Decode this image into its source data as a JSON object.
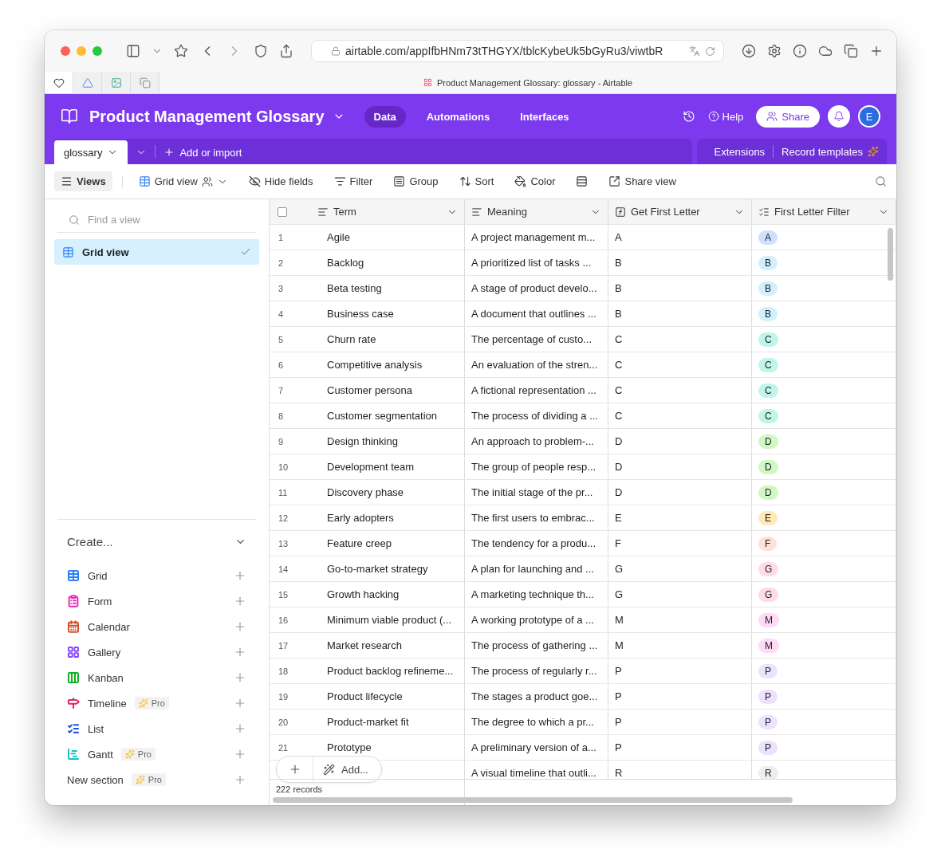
{
  "browser": {
    "url": "airtable.com/appIfbHNm73tTHGYX/tblcKybeUk5bGyRu3/viwtbR",
    "tab_title": "Product Management Glossary: glossary - Airtable"
  },
  "header": {
    "title": "Product Management Glossary",
    "nav": [
      {
        "label": "Data",
        "selected": true
      },
      {
        "label": "Automations",
        "selected": false
      },
      {
        "label": "Interfaces",
        "selected": false
      }
    ],
    "help": "Help",
    "share": "Share",
    "avatar": "E"
  },
  "table_tabs": {
    "tabs": [
      {
        "label": "glossary",
        "selected": true
      }
    ],
    "add": "Add or import",
    "right": [
      "Extensions",
      "Record templates"
    ]
  },
  "toolbar": {
    "views": "Views",
    "view_name": "Grid view",
    "buttons": [
      {
        "label": "Hide fields",
        "kind": "hide"
      },
      {
        "label": "Filter",
        "kind": "filter"
      },
      {
        "label": "Group",
        "kind": "group"
      },
      {
        "label": "Sort",
        "kind": "sort"
      },
      {
        "label": "Color",
        "kind": "color"
      },
      {
        "kind": "height"
      },
      {
        "label": "Share view",
        "kind": "share"
      }
    ]
  },
  "sidebar": {
    "search": {
      "placeholder": "Find a view"
    },
    "views": [
      {
        "label": "Grid view",
        "selected": true
      }
    ],
    "create_title": "Create...",
    "create_items": [
      {
        "label": "Grid",
        "kind": "grid",
        "color": "#2d7ff9"
      },
      {
        "label": "Form",
        "kind": "form",
        "color": "#e929ba"
      },
      {
        "label": "Calendar",
        "kind": "calendar",
        "color": "#d74d26"
      },
      {
        "label": "Gallery",
        "kind": "gallery",
        "color": "#8b46ff"
      },
      {
        "label": "Kanban",
        "kind": "kanban",
        "color": "#11af22"
      },
      {
        "label": "Timeline",
        "kind": "timeline",
        "color": "#e0245e",
        "badge": "Pro"
      },
      {
        "label": "List",
        "kind": "list",
        "color": "#1d4ed8"
      },
      {
        "label": "Gantt",
        "kind": "gantt",
        "color": "#18bfbf",
        "badge": "Pro"
      },
      {
        "label": "New section",
        "kind": "section",
        "badge": "Pro"
      }
    ]
  },
  "table": {
    "select_all": {
      "checked": false
    },
    "columns": [
      {
        "label": "Term",
        "kind": "text"
      },
      {
        "label": "Meaning",
        "kind": "text"
      },
      {
        "label": "Get First Letter",
        "kind": "formula"
      },
      {
        "label": "First Letter Filter",
        "kind": "select"
      }
    ],
    "rows": [
      {
        "number": "1",
        "term": "Agile",
        "meaning": "A project management m...",
        "letter": "A",
        "tag": {
          "label": "A",
          "color": "#cfdfff"
        }
      },
      {
        "number": "2",
        "term": "Backlog",
        "meaning": "A prioritized list of tasks ...",
        "letter": "B",
        "tag": {
          "label": "B",
          "color": "#d0f0fd"
        }
      },
      {
        "number": "3",
        "term": "Beta testing",
        "meaning": "A stage of product develo...",
        "letter": "B",
        "tag": {
          "label": "B",
          "color": "#d0f0fd"
        }
      },
      {
        "number": "4",
        "term": "Business case",
        "meaning": "A document that outlines ...",
        "letter": "B",
        "tag": {
          "label": "B",
          "color": "#d0f0fd"
        }
      },
      {
        "number": "5",
        "term": "Churn rate",
        "meaning": "The percentage of custo...",
        "letter": "C",
        "tag": {
          "label": "C",
          "color": "#c2f5e9"
        }
      },
      {
        "number": "6",
        "term": "Competitive analysis",
        "meaning": "An evaluation of the stren...",
        "letter": "C",
        "tag": {
          "label": "C",
          "color": "#c2f5e9"
        }
      },
      {
        "number": "7",
        "term": "Customer persona",
        "meaning": "A fictional representation ...",
        "letter": "C",
        "tag": {
          "label": "C",
          "color": "#c2f5e9"
        }
      },
      {
        "number": "8",
        "term": "Customer segmentation",
        "meaning": "The process of dividing a ...",
        "letter": "C",
        "tag": {
          "label": "C",
          "color": "#c2f5e9"
        }
      },
      {
        "number": "9",
        "term": "Design thinking",
        "meaning": "An approach to problem-...",
        "letter": "D",
        "tag": {
          "label": "D",
          "color": "#d1f7c4"
        }
      },
      {
        "number": "10",
        "term": "Development team",
        "meaning": "The group of people resp...",
        "letter": "D",
        "tag": {
          "label": "D",
          "color": "#d1f7c4"
        }
      },
      {
        "number": "11",
        "term": "Discovery phase",
        "meaning": "The initial stage of the pr...",
        "letter": "D",
        "tag": {
          "label": "D",
          "color": "#d1f7c4"
        }
      },
      {
        "number": "12",
        "term": "Early adopters",
        "meaning": "The first users to embrac...",
        "letter": "E",
        "tag": {
          "label": "E",
          "color": "#ffeab6"
        }
      },
      {
        "number": "13",
        "term": "Feature creep",
        "meaning": "The tendency for a produ...",
        "letter": "F",
        "tag": {
          "label": "F",
          "color": "#fee2d5"
        }
      },
      {
        "number": "14",
        "term": "Go-to-market strategy",
        "meaning": "A plan for launching and ...",
        "letter": "G",
        "tag": {
          "label": "G",
          "color": "#ffdce5"
        }
      },
      {
        "number": "15",
        "term": "Growth hacking",
        "meaning": "A marketing technique th...",
        "letter": "G",
        "tag": {
          "label": "G",
          "color": "#ffdce5"
        }
      },
      {
        "number": "16",
        "term": "Minimum viable product (...",
        "meaning": "A working prototype of a ...",
        "letter": "M",
        "tag": {
          "label": "M",
          "color": "#ffdaf6"
        }
      },
      {
        "number": "17",
        "term": "Market research",
        "meaning": "The process of gathering ...",
        "letter": "M",
        "tag": {
          "label": "M",
          "color": "#ffdaf6"
        }
      },
      {
        "number": "18",
        "term": "Product backlog refineme...",
        "meaning": "The process of regularly r...",
        "letter": "P",
        "tag": {
          "label": "P",
          "color": "#ede2fe"
        }
      },
      {
        "number": "19",
        "term": "Product lifecycle",
        "meaning": "The stages a product goe...",
        "letter": "P",
        "tag": {
          "label": "P",
          "color": "#ede2fe"
        }
      },
      {
        "number": "20",
        "term": "Product-market fit",
        "meaning": "The degree to which a pr...",
        "letter": "P",
        "tag": {
          "label": "P",
          "color": "#ede2fe"
        }
      },
      {
        "number": "21",
        "term": "Prototype",
        "meaning": "A preliminary version of a...",
        "letter": "P",
        "tag": {
          "label": "P",
          "color": "#ede2fe"
        }
      },
      {
        "meaning": "A visual timeline that outli...",
        "letter": "R",
        "tag": {
          "label": "R",
          "color": "#eeeeee"
        }
      }
    ],
    "add": "Add...",
    "footer": "222 records"
  }
}
